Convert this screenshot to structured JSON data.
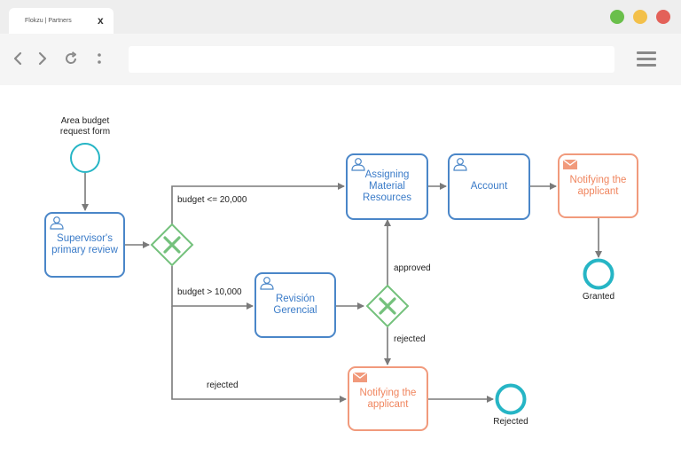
{
  "browser": {
    "tab_title": "Flokzu | Partners",
    "tab_close": "x",
    "dots": {
      "green": "#6abf4b",
      "yellow": "#f3c04a",
      "red": "#e36159"
    }
  },
  "diagram": {
    "start_label": "Area budget\nrequest form",
    "tasks": {
      "supervisor": "Supervisor's\nprimary review",
      "assigning": "Assigning\nMaterial\nResources",
      "account": "Account",
      "notify_top": "Notifying the\napplicant",
      "revision": "Revisión\nGerencial",
      "notify_bottom": "Notifying the\napplicant"
    },
    "flow_labels": {
      "budget_le": "budget <= 20,000",
      "budget_gt": "budget > 10,000",
      "approved": "approved",
      "rejected_gw": "rejected",
      "rejected_bottom": "rejected"
    },
    "end_labels": {
      "granted": "Granted",
      "rejected": "Rejected"
    },
    "colors": {
      "task_border": "#4a86c8",
      "task_text": "#3a7bc8",
      "mail_border": "#f19a7c",
      "mail_text": "#f0855e",
      "gateway": "#74c17c",
      "event": "#26b5c5",
      "arrow": "#7a7a7a"
    }
  }
}
